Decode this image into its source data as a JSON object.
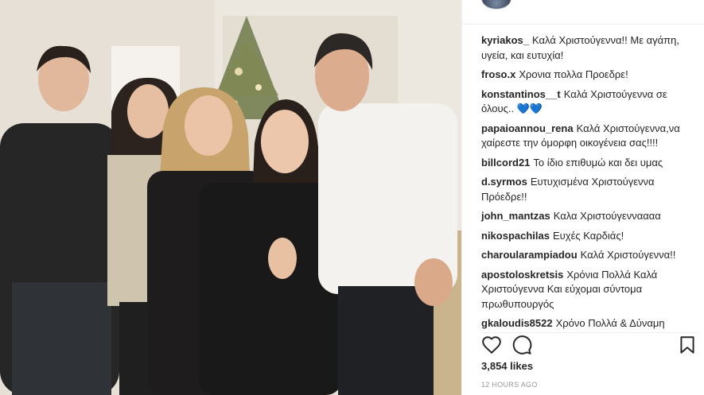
{
  "photo": {
    "alt_description_icon": "family-photo"
  },
  "comments": [
    {
      "user": "kyriakos_",
      "text": "Καλά Χριστούγεννα!! Με αγάπη, υγεία, και ευτυχία!"
    },
    {
      "user": "froso.x",
      "text": "Χρονια πολλα Προεδρε!"
    },
    {
      "user": "konstantinos__t",
      "text": "Καλά Χριστούγεννα σε όλους..",
      "emoji": "💙💙"
    },
    {
      "user": "papaioannou_rena",
      "text": "Καλά Χριστούγεννα,να χαίρεστε την όμορφη οικογένεια σας!!!!"
    },
    {
      "user": "billcord21",
      "text": "Το ίδιο επιθυμώ και δει υμας"
    },
    {
      "user": "d.syrmos",
      "text": "Ευτυχισμένα Χριστούγεννα Πρόεδρε!!"
    },
    {
      "user": "john_mantzas",
      "text": "Καλα Χριστούγενναααα"
    },
    {
      "user": "nikospachilas",
      "text": "Ευχές Καρδιάς!"
    },
    {
      "user": "charoularampiadou",
      "text": "Καλά Χριστούγεννα!!"
    },
    {
      "user": "apostoloskretsis",
      "text": "Χρόνια Πολλά Καλά Χριστούγεννα Και εύχομαι σύντομα πρωθυπουργός"
    },
    {
      "user": "gkaloudis8522",
      "text": "Χρόνο Πολλά & Δύναμη"
    }
  ],
  "actions": {
    "like_icon": "heart-outline-icon",
    "comment_icon": "comment-bubble-icon",
    "save_icon": "bookmark-icon"
  },
  "likes_text": "3,854 likes",
  "time_text": "12 HOURS AGO",
  "colors": {
    "text": "#262626",
    "muted": "#999999",
    "divider": "#efefef",
    "accent_blue": "#3897f0"
  }
}
